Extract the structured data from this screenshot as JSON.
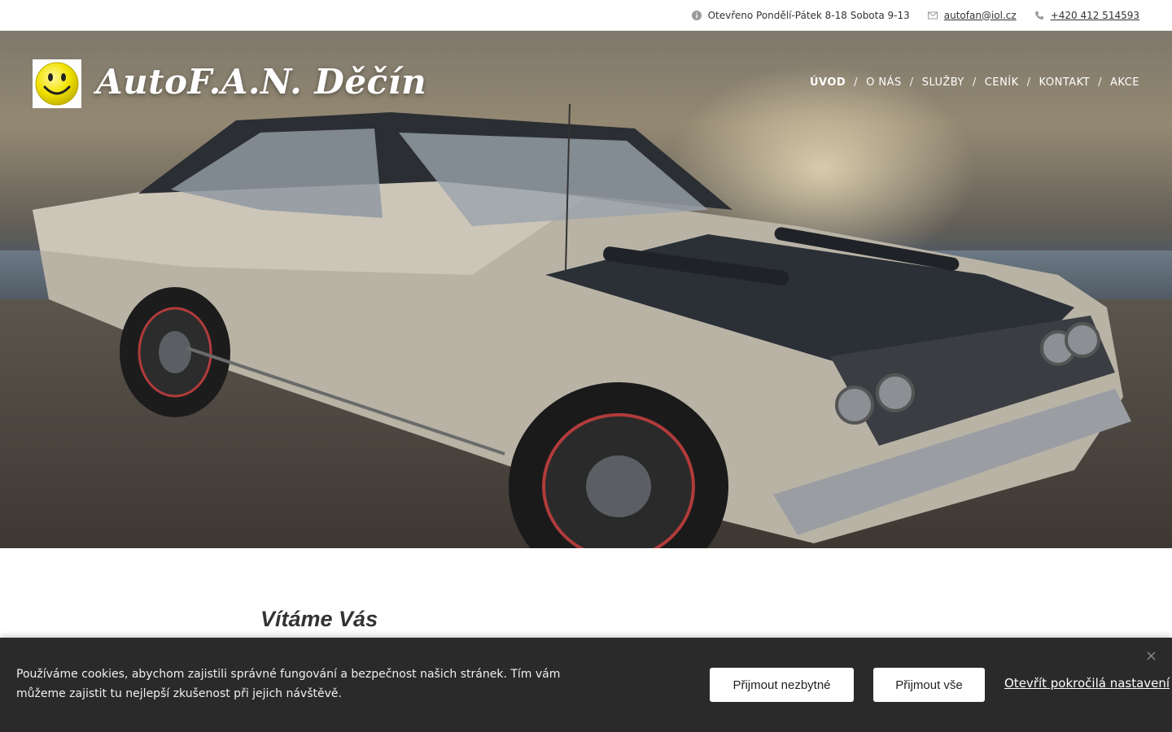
{
  "topbar": {
    "hours": "Otevřeno Pondělí-Pátek 8-18 Sobota 9-13",
    "email": "autofan@iol.cz",
    "phone": "+420 412 514593"
  },
  "header": {
    "title": "AutoF.A.N. Děčín",
    "logo_icon": "smiley-icon",
    "nav": [
      {
        "label": "Úvod",
        "active": true
      },
      {
        "label": "O nás",
        "active": false
      },
      {
        "label": "Služby",
        "active": false
      },
      {
        "label": "Ceník",
        "active": false
      },
      {
        "label": "Kontakt",
        "active": false
      },
      {
        "label": "Akce",
        "active": false
      }
    ],
    "separator": "/"
  },
  "main": {
    "welcome_heading": "Vítáme Vás"
  },
  "cookie_bar": {
    "text": "Používáme cookies, abychom zajistili správné fungování a bezpečnost našich stránek. Tím vám můžeme zajistit tu nejlepší zkušenost při jejich návštěvě.",
    "accept_necessary": "Přijmout nezbytné",
    "accept_all": "Přijmout vše",
    "advanced_settings": "Otevřít pokročilá nastavení",
    "close_label": "×"
  },
  "colors": {
    "cookie_bg": "#2a2a2a",
    "text_dark": "#333333"
  }
}
